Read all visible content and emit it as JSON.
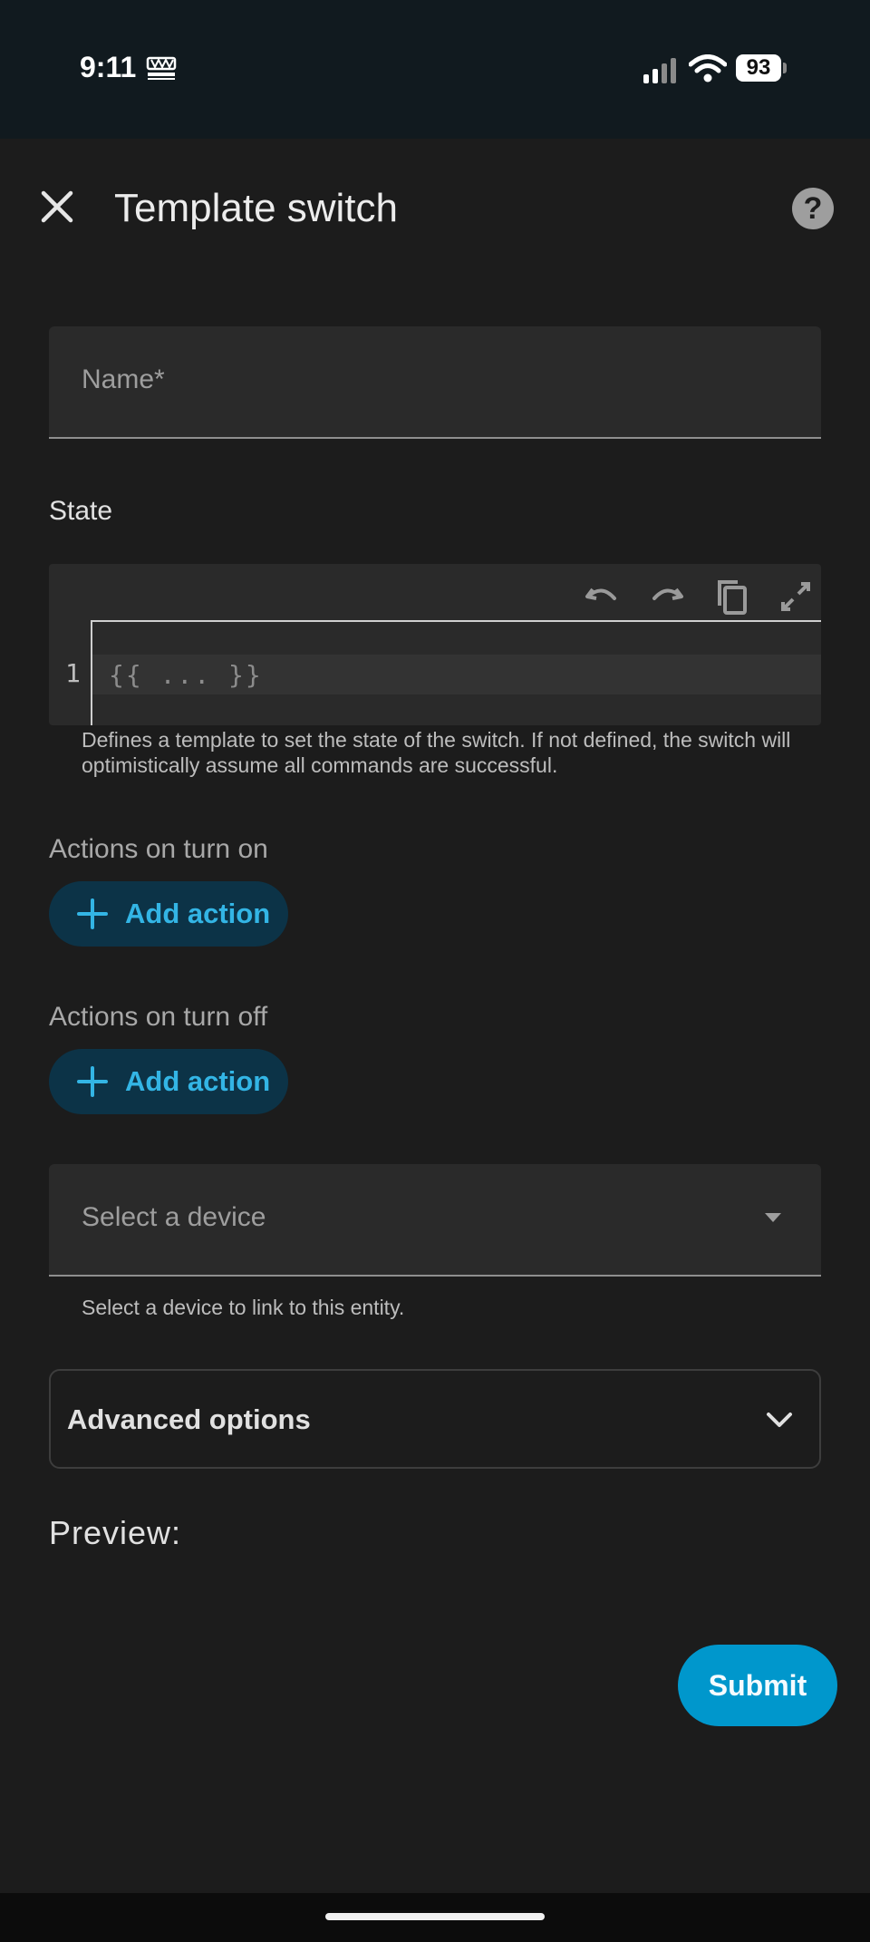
{
  "status_bar": {
    "time": "9:11",
    "battery": "93",
    "icons": [
      "owna-app-icon",
      "signal-icon",
      "wifi-icon",
      "battery-icon"
    ]
  },
  "header": {
    "title": "Template switch",
    "close_icon": "close-icon",
    "help_icon": "help-icon",
    "help_glyph": "?"
  },
  "name_field": {
    "placeholder": "Name*"
  },
  "state": {
    "label": "State",
    "editor": {
      "line_number": "1",
      "code_placeholder": "{{ ... }}",
      "tools": [
        "undo-icon",
        "redo-icon",
        "copy-icon",
        "fullscreen-icon"
      ]
    },
    "helper": "Defines a template to set the state of the switch. If not defined, the switch will optimistically assume all commands are successful."
  },
  "turn_on": {
    "label": "Actions on turn on",
    "button": "Add action"
  },
  "turn_off": {
    "label": "Actions on turn off",
    "button": "Add action"
  },
  "device": {
    "placeholder": "Select a device",
    "helper": "Select a device to link to this entity."
  },
  "advanced": {
    "label": "Advanced options"
  },
  "preview": {
    "label": "Preview:"
  },
  "submit": {
    "label": "Submit"
  },
  "colors": {
    "background": "#1c1c1c",
    "status_bar": "#111a1f",
    "field": "#2a2a2a",
    "accent": "#33b5e5",
    "pill_bg": "#0c3347",
    "submit_bg": "#0097cc"
  }
}
